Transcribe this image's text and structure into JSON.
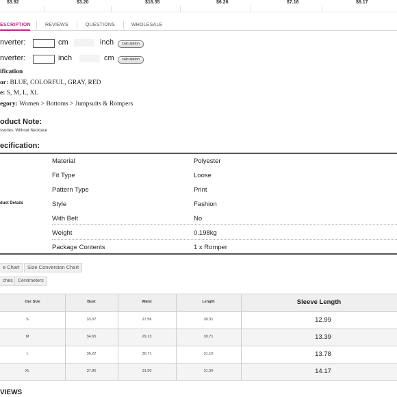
{
  "prices": [
    "$3.92",
    "$3.20",
    "$16.35",
    "$6.26",
    "$7.16",
    "$6.17"
  ],
  "tabs": [
    {
      "label": "ESCRIPTION",
      "active": true
    },
    {
      "label": "REVIEWS",
      "active": false
    },
    {
      "label": "QUESTIONS",
      "active": false
    },
    {
      "label": "WHOLESALE",
      "active": false
    }
  ],
  "converter": [
    {
      "label": "nverter:",
      "unit_a": "cm",
      "unit_b": "inch",
      "button": "calculation"
    },
    {
      "label": "nverter:",
      "unit_a": "inch",
      "unit_b": "cm",
      "button": "calculation"
    }
  ],
  "spec_summary": {
    "heading": "ification",
    "lines": [
      {
        "key": "or:",
        "value": " BLUE, COLORFUL, GRAY, RED"
      },
      {
        "key": "e:",
        "value": " S, M, L, XL"
      },
      {
        "key": "egory:",
        "value": " Women > Bottoms > Jumpsuits & Rompers"
      }
    ]
  },
  "product_note": {
    "heading": "oduct Note:",
    "text": "ssories: Without Necklace"
  },
  "specification": {
    "heading": "ecification:",
    "group_label": "duct Details",
    "rows": [
      {
        "label": "Material",
        "value": "Polyester"
      },
      {
        "label": "Fit Type",
        "value": "Loose"
      },
      {
        "label": "Pattern Type",
        "value": "Print"
      },
      {
        "label": "Style",
        "value": "Fashion"
      },
      {
        "label": "With Belt",
        "value": "No"
      },
      {
        "label": "Weight",
        "value": "0.198kg"
      },
      {
        "label": "Package Contents",
        "value": "1 x Romper"
      }
    ]
  },
  "size_tabs": [
    "e Chart",
    "Size Conversion Chart"
  ],
  "unit_tabs": [
    "ches",
    "Centimeters"
  ],
  "size_table": {
    "headers": [
      "Our Size",
      "Bust",
      "Waist",
      "Length",
      "Sleeve Length"
    ],
    "rows": [
      [
        "S",
        "33.07",
        "27.56",
        "30.31",
        "12.99"
      ],
      [
        "M",
        "34.65",
        "29.13",
        "30.71",
        "13.39"
      ],
      [
        "L",
        "36.22",
        "30.71",
        "31.10",
        "13.78"
      ],
      [
        "XL",
        "37.80",
        "31.50",
        "31.50",
        "14.17"
      ]
    ]
  },
  "footer_heading": "VIEWS",
  "colors": {
    "accent": "#c0268a"
  }
}
